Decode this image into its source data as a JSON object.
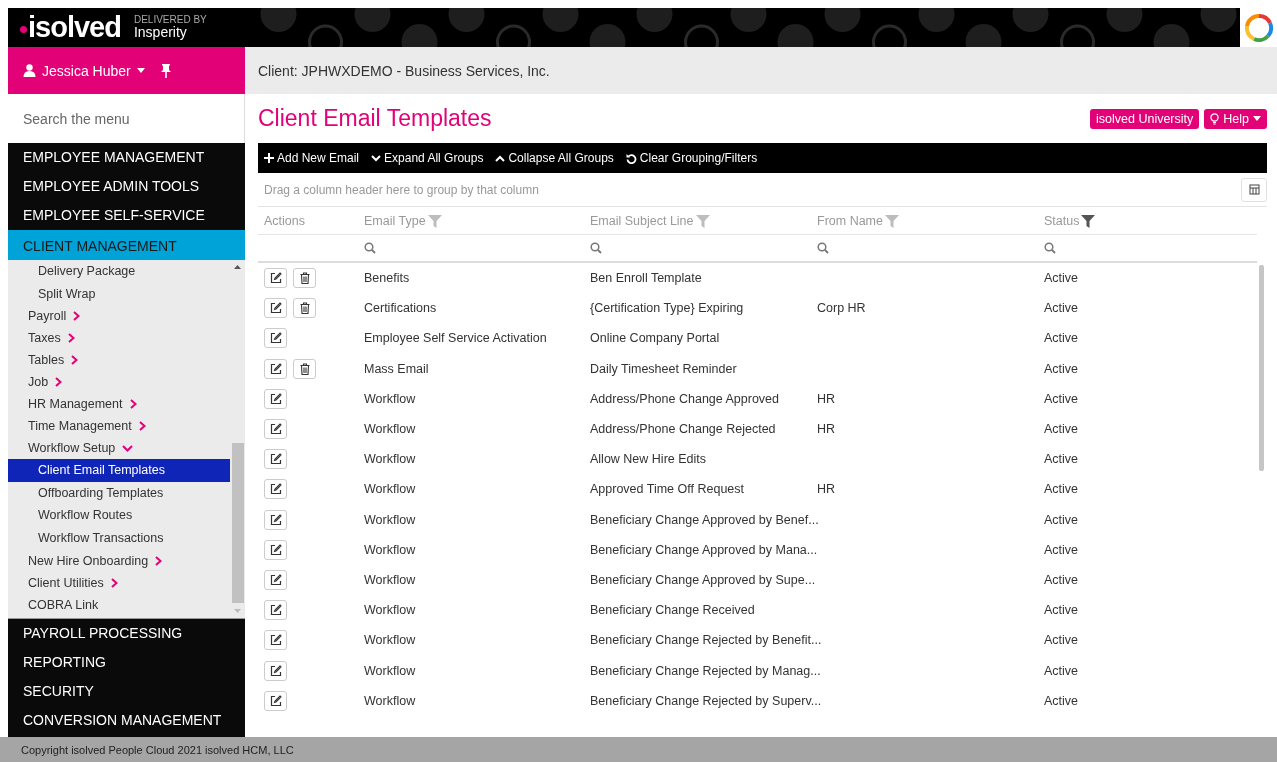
{
  "header": {
    "logo": "isolved",
    "delivered_by": "DELIVERED BY",
    "partner": "Insperity"
  },
  "user": {
    "name": "Jessica Huber"
  },
  "client_bar": {
    "text": "Client: JPHWXDEMO - Business Services, Inc."
  },
  "sidebar": {
    "search": {
      "placeholder": "Search the menu"
    },
    "sections_top": [
      {
        "label": "EMPLOYEE MANAGEMENT",
        "selected": false
      },
      {
        "label": "EMPLOYEE ADMIN TOOLS",
        "selected": false
      },
      {
        "label": "EMPLOYEE SELF-SERVICE",
        "selected": false
      },
      {
        "label": "CLIENT MANAGEMENT",
        "selected": true
      }
    ],
    "submenu": {
      "orphan_children": [
        {
          "label": "Delivery Package",
          "selected": false
        },
        {
          "label": "Split Wrap",
          "selected": false
        }
      ],
      "items": [
        {
          "label": "Payroll",
          "expanded": false
        },
        {
          "label": "Taxes",
          "expanded": false
        },
        {
          "label": "Tables",
          "expanded": false
        },
        {
          "label": "Job",
          "expanded": false
        },
        {
          "label": "HR Management",
          "expanded": false
        },
        {
          "label": "Time Management",
          "expanded": false
        },
        {
          "label": "Workflow Setup",
          "expanded": true,
          "children": [
            {
              "label": "Client Email Templates",
              "selected": true
            },
            {
              "label": "Offboarding Templates",
              "selected": false
            },
            {
              "label": "Workflow Routes",
              "selected": false
            },
            {
              "label": "Workflow Transactions",
              "selected": false
            }
          ]
        },
        {
          "label": "New Hire Onboarding",
          "expanded": false
        },
        {
          "label": "Client Utilities",
          "expanded": false
        },
        {
          "label": "COBRA Link"
        }
      ]
    },
    "sections_bottom": [
      {
        "label": "PAYROLL PROCESSING",
        "selected": false
      },
      {
        "label": "REPORTING",
        "selected": false
      },
      {
        "label": "SECURITY",
        "selected": false
      },
      {
        "label": "CONVERSION MANAGEMENT",
        "selected": false
      }
    ]
  },
  "page": {
    "title": "Client Email Templates",
    "buttons": [
      {
        "label": "isolved University",
        "kind": "plain"
      },
      {
        "label": "Help",
        "kind": "help"
      }
    ]
  },
  "toolbar": [
    {
      "label": "Add New Email",
      "kind": "add"
    },
    {
      "label": "Expand All Groups",
      "kind": "expand"
    },
    {
      "label": "Collapse All Groups",
      "kind": "collapse"
    },
    {
      "label": "Clear Grouping/Filters",
      "kind": "reset"
    }
  ],
  "grid": {
    "group_hint": "Drag a column header here to group by that column",
    "columns": [
      {
        "label": "Actions"
      },
      {
        "label": "Email Type",
        "filter_active": false
      },
      {
        "label": "Email Subject Line",
        "filter_active": false
      },
      {
        "label": "From Name",
        "filter_active": false
      },
      {
        "label": "Status",
        "filter_active": true
      }
    ],
    "rows": [
      {
        "deletable": true,
        "type": "Benefits",
        "subject": "Ben Enroll Template",
        "from": "",
        "status": "Active"
      },
      {
        "deletable": true,
        "type": "Certifications",
        "subject": "{Certification Type} Expiring",
        "from": "Corp HR",
        "status": "Active"
      },
      {
        "deletable": false,
        "type": "Employee Self Service Activation",
        "subject": "Online Company Portal",
        "from": "",
        "status": "Active"
      },
      {
        "deletable": true,
        "type": "Mass Email",
        "subject": "Daily Timesheet Reminder",
        "from": "",
        "status": "Active"
      },
      {
        "deletable": false,
        "type": "Workflow",
        "subject": "Address/Phone Change Approved",
        "from": "HR",
        "status": "Active"
      },
      {
        "deletable": false,
        "type": "Workflow",
        "subject": "Address/Phone Change Rejected",
        "from": "HR",
        "status": "Active"
      },
      {
        "deletable": false,
        "type": "Workflow",
        "subject": "Allow New Hire Edits",
        "from": "",
        "status": "Active"
      },
      {
        "deletable": false,
        "type": "Workflow",
        "subject": "Approved Time Off Request",
        "from": "HR",
        "status": "Active"
      },
      {
        "deletable": false,
        "type": "Workflow",
        "subject": "Beneficiary Change Approved by Benef...",
        "from": "",
        "status": "Active"
      },
      {
        "deletable": false,
        "type": "Workflow",
        "subject": "Beneficiary Change Approved by Mana...",
        "from": "",
        "status": "Active"
      },
      {
        "deletable": false,
        "type": "Workflow",
        "subject": "Beneficiary Change Approved by Supe...",
        "from": "",
        "status": "Active"
      },
      {
        "deletable": false,
        "type": "Workflow",
        "subject": "Beneficiary Change Received",
        "from": "",
        "status": "Active"
      },
      {
        "deletable": false,
        "type": "Workflow",
        "subject": "Beneficiary Change Rejected by Benefit...",
        "from": "",
        "status": "Active"
      },
      {
        "deletable": false,
        "type": "Workflow",
        "subject": "Beneficiary Change Rejected by Manag...",
        "from": "",
        "status": "Active"
      },
      {
        "deletable": false,
        "type": "Workflow",
        "subject": "Beneficiary Change Rejected by Superv...",
        "from": "",
        "status": "Active"
      }
    ]
  },
  "footer": {
    "text": "Copyright isolved People Cloud 2021 isolved HCM, LLC"
  }
}
